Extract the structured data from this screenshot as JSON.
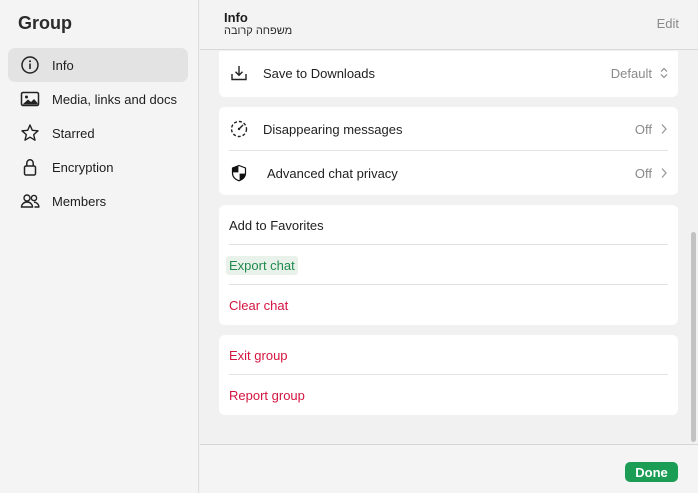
{
  "sidebar": {
    "title": "Group",
    "items": [
      {
        "label": "Info",
        "icon": "info-icon"
      },
      {
        "label": "Media, links and docs",
        "icon": "image-icon"
      },
      {
        "label": "Starred",
        "icon": "star-icon"
      },
      {
        "label": "Encryption",
        "icon": "lock-icon"
      },
      {
        "label": "Members",
        "icon": "members-icon"
      }
    ]
  },
  "header": {
    "title": "Info",
    "subtitle": "משפחה קרובה",
    "edit_label": "Edit"
  },
  "settings": {
    "save_to_downloads": {
      "label": "Save to Downloads",
      "value": "Default",
      "icon": "download-icon"
    },
    "disappearing_messages": {
      "label": "Disappearing messages",
      "value": "Off",
      "icon": "timer-icon"
    },
    "advanced_privacy": {
      "label": "Advanced chat privacy",
      "value": "Off",
      "icon": "shield-icon"
    }
  },
  "actions": {
    "add_favorites": "Add to Favorites",
    "export_chat": "Export chat",
    "clear_chat": "Clear chat",
    "exit_group": "Exit group",
    "report_group": "Report group"
  },
  "footer": {
    "done_label": "Done"
  },
  "colors": {
    "accent_green": "#1c9d56",
    "link_green": "#1f8a4c",
    "danger_red": "#d4143f"
  }
}
